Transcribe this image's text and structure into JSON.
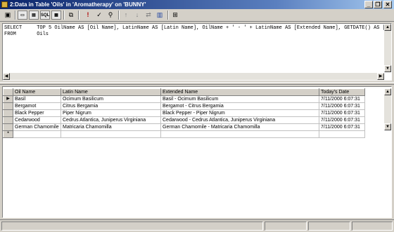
{
  "window": {
    "title": "2:Data in Table 'Oils' in 'Aromatherapy' on 'BUNNY'",
    "minimize": "_",
    "restore": "❐",
    "close": "✕"
  },
  "toolbar": {
    "buttons": [
      {
        "name": "run-query-icon",
        "glyph": "▣"
      },
      {
        "name": "show-diagram-pane-icon",
        "glyph": "▭"
      },
      {
        "name": "show-grid-pane-icon",
        "glyph": "▤"
      },
      {
        "name": "show-sql-pane-icon",
        "glyph": "SQL"
      },
      {
        "name": "show-results-pane-icon",
        "glyph": "▦"
      },
      {
        "name": "change-query-type-icon",
        "glyph": "⧉"
      },
      {
        "name": "execute-icon",
        "glyph": "!"
      },
      {
        "name": "verify-sql-icon",
        "glyph": "✓"
      },
      {
        "name": "remove-filter-icon",
        "glyph": "⚲"
      },
      {
        "name": "sort-ascending-icon",
        "glyph": "↑"
      },
      {
        "name": "sort-descending-icon",
        "glyph": "↓"
      },
      {
        "name": "group-by-icon",
        "glyph": "⇄"
      },
      {
        "name": "properties-icon",
        "glyph": "▥"
      },
      {
        "name": "add-table-icon",
        "glyph": "⊞"
      }
    ]
  },
  "sql": {
    "line1": "SELECT     TOP 5 OilName AS [Oil Name], LatinName AS [Latin Name], OilName + ' - ' + LatinName AS [Extended Name], GETDATE() AS [Today's Date]",
    "line2": "FROM       Oils"
  },
  "grid": {
    "columns": [
      "Oil Name",
      "Latin Name",
      "Extended Name",
      "Today's Date"
    ],
    "rows": [
      [
        "Basil",
        "Ocimum Basilicum",
        "Basil - Ocimum Basilicum",
        "7/11/2000 6:07:31"
      ],
      [
        "Bergamot",
        "Citrus Bergamia",
        "Bergamot - Citrus Bergamia",
        "7/11/2000 6:07:31"
      ],
      [
        "Black Pepper",
        "Piper Nigrum",
        "Black Pepper - Piper Nigrum",
        "7/11/2000 6:07:31"
      ],
      [
        "Cedarwood",
        "Cedrus Atlantica, Juniperus Virginiana",
        "Cedarwood - Cedrus Atlantica, Juniperus Virginiana",
        "7/11/2000 6:07:31"
      ],
      [
        "German Chamomile",
        "Matricaria Chamomilla",
        "German Chamomile - Matricaria Chamomilla",
        "7/11/2000 6:07:31"
      ]
    ],
    "current_row_marker": "▶",
    "new_row_marker": "*"
  }
}
